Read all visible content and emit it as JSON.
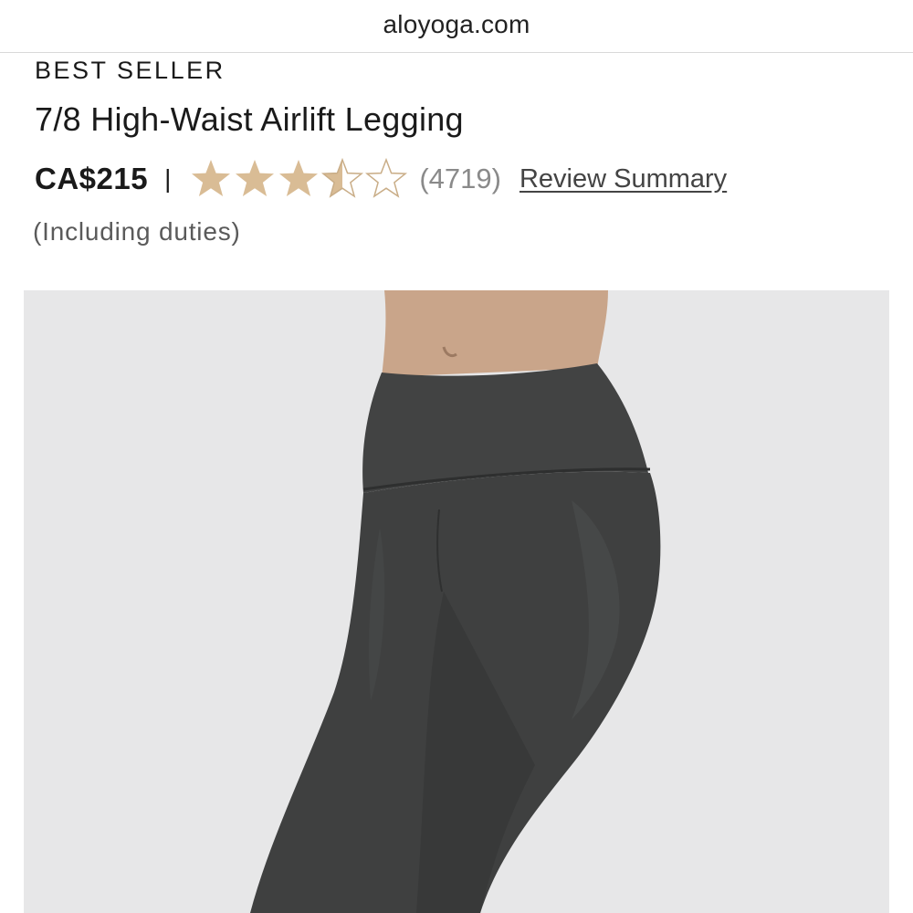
{
  "browser": {
    "url": "aloyoga.com"
  },
  "product": {
    "badge": "BEST SELLER",
    "title": "7/8 High-Waist Airlift Legging",
    "price": "CA$215",
    "divider": "|",
    "rating": 3.5,
    "rating_max": 5,
    "review_count": "(4719)",
    "review_summary_link": "Review Summary",
    "duties_note": "(Including duties)",
    "image_icon": "product-photo-legging"
  },
  "colors": {
    "star_filled": "#d9bc95",
    "star_empty_outline": "#c9ad87",
    "image_background": "#e7e7e8",
    "legging": "#3f4040"
  }
}
